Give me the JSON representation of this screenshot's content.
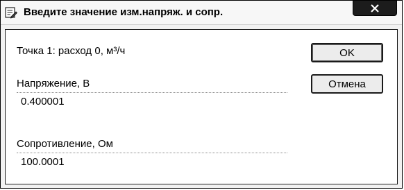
{
  "window": {
    "title": "Введите значение изм.напряж. и сопр."
  },
  "form": {
    "point_label": "Точка 1: расход 0, м³/ч",
    "voltage_label": "Напряжение, В",
    "voltage_value": "0.400001",
    "resistance_label": "Сопротивление, Ом",
    "resistance_value": "100.0001"
  },
  "buttons": {
    "ok_label": "OK",
    "cancel_label": "Отмена"
  },
  "icons": {
    "app": "dialog-edit-icon",
    "close": "close-icon"
  }
}
